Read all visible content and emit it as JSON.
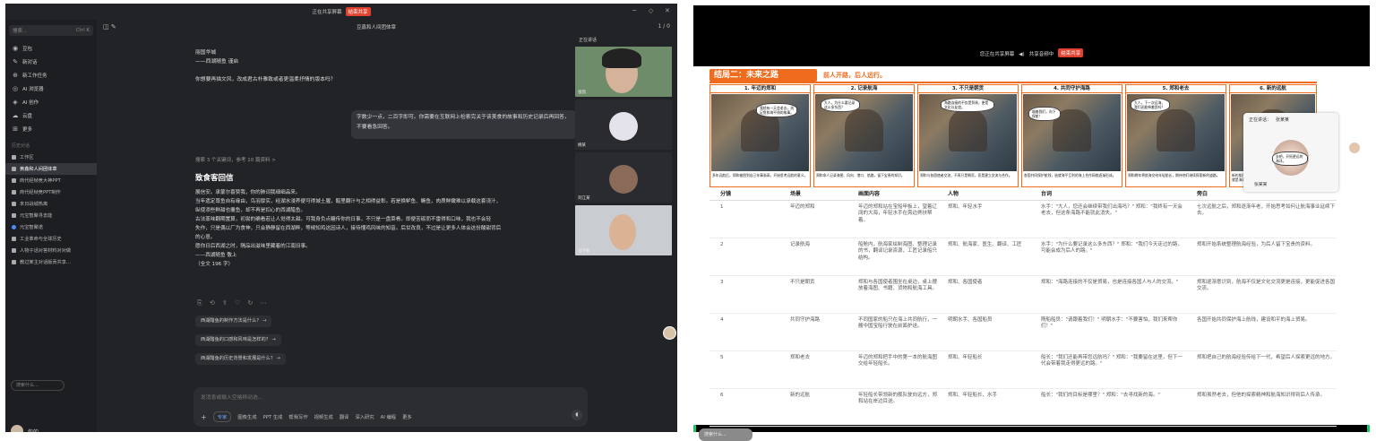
{
  "left": {
    "topbar": {
      "sharing": "正在共享屏幕",
      "stop": "结束共享"
    },
    "sidebar": {
      "search": "搜索...",
      "shortcut": "Ctrl K",
      "nav": [
        "豆包",
        "新对话",
        "新工作任务",
        "AI 浏览器",
        "AI 创作",
        "云盘",
        "更多"
      ],
      "section": "历史对话",
      "history": [
        "工作区",
        "黄鑫和人间团体章",
        "商代经帧竞大神PPT",
        "商代经帧竞PPT制作",
        "末日战城热离",
        "元宝智聚寻去能",
        "元宝智聚诺",
        "工业革命与全球历史",
        "人物子话对答材料对对做",
        "教过某主对话版贡共享…"
      ],
      "search_box": "搜索什么...",
      "username": "你的"
    },
    "main": {
      "title": "豆鑫和人间团体章",
      "header_right": "1 / 0",
      "chat_lines": [
        "丽国华城",
        "——西湖随鱼 谨启",
        "你想要再描文风，改成君古朴雅致或者更温柔抒情的版本吗？"
      ],
      "bubble": "字数少一点，二百字即可。你需要在互联网上检索完关于该美食的故事和历史记录后再回答，不要看急回答。",
      "search_note": "搜索 3 个关键词，参考 10 篇资料 >",
      "reply_title": "致食客回信",
      "reply_lines": [
        "展信安。承蒙尔喜赞我，你的肺词我细细品来。",
        "当年遗定尊鱼自有缘由，鸟羽厚实，经湖水浸养便可得城土腥，醋里翻汁与之相得益彰。若是换鲈鱼、鳜鱼，肉质鲜嫩难以承载这套浇汁，",
        "纵使添些鲜甜也覆鱼，却不再是扣心的西湖醋鱼。",
        "古法蒸味翻期置算，初尝的确看若让人觉得太甜。可我身负点糖传你的日事，不只是一盘菜肴。即便苦砺而不雷得和口味，我也不会轻",
        "失作，只是偶以厂为食神，只会静静留在西湖畔，等候知鸡这因诗人，接待懂鸡风味的知音。后甘改良，不过是让更多人体会这份酸甜背后",
        "的心意。",
        "愿你日后西湖之时，隔品出滋味里藏着的江南旧事。",
        "——西湖随鱼 敬上",
        "（全文 196 字）"
      ],
      "suggestions": [
        "西湖醋鱼的制作方法是什么？ →",
        "西湖醋鱼的口感和风味是怎样的？ →",
        "西湖醋鱼的历史背景和发展是什么？ →"
      ],
      "input_placeholder": "发消息或输入空格移动选...",
      "tools": [
        "专家",
        "图像生成",
        "PPT 生成",
        "帮我写作",
        "视频生成",
        "翻译",
        "深入研究",
        "AI 编程",
        "更多"
      ]
    },
    "video": {
      "header": "正在讲话",
      "names": [
        "张凯",
        "杨某",
        "刘江某",
        "甘子枫"
      ]
    }
  },
  "right": {
    "topbar": {
      "sharing": "您正在共享屏幕",
      "audio": "共享音频中",
      "stop": "结束共享"
    },
    "slide": {
      "banner": "结局二：未来之路",
      "subtitle": "前人开路，后人远行。",
      "panels": [
        {
          "title": "1. 年迈的郑和",
          "speech": "我经有一天会老去，流足鱼和海平线的故事。",
          "caption": "多年远航后，郑和被困到自己年事渐高，开始思考远航的意义。"
        },
        {
          "title": "2. 记录航海",
          "speech": "大人，为什么要记录这么多东西？",
          "caption": "郑和命人记录海图、风向、港口、航路，留下宝贵的知识。"
        },
        {
          "title": "3. 不只是朝贡",
          "speech": "海路连接的不仅是贸易，更是文化与友谊。",
          "caption": "郑和与各国使者交流，不再只是朝贡，而是建立交流与合作。"
        },
        {
          "title": "4. 共同守护海路",
          "speech": "顺着我们，向下保航！",
          "caption": "各国共同保护航线，造就海平互利的海上合作网络逐渐形成。"
        },
        {
          "title": "5. 郑和老去",
          "speech": "大人，下一次远海，我们还能带着您吗？",
          "caption": "郑和晚年将航海交给年轻船长，期待他们继续探索新的道路。"
        },
        {
          "title": "6. 新的远航",
          "speech": "去吧，开拓更远的海洋。",
          "caption": "新的船队扬帆远航，郑和的精神与知识被后人传承，这就是海事精神的永恒。"
        }
      ],
      "table": {
        "headers": [
          "分镜",
          "场景",
          "画面内容",
          "人物",
          "台词",
          "旁白"
        ],
        "rows": [
          [
            "1",
            "年迈的郑和",
            "年迈的郑和站在宝船甲板上，望着辽阔的大海，年轻水手在旁边搀扶帮着。",
            "郑和、年轻水手",
            "水手：\"大人，您还会继续带我们出海吗？\" 郑和：\"我终有一天会老去，但这条海路不能就此消失。\"",
            "七次远航之后，郑和逐渐年老，开始思考如何让航海事业延续下去。"
          ],
          [
            "2",
            "记录航海",
            "船舱内，航海家绘制海图、整理记录的书，翻译记录资源，工匠记录船只结构。",
            "郑和、航海家、医生、翻译、工匠",
            "水手：\"为什么要记录这么多东西？\" 郑和：\"我们今天走过的路，可能会成为后人的路。\"",
            "郑和开始系统整理航海经验，为后人留下宝贵的资料。"
          ],
          [
            "3",
            "不只是朝贡",
            "郑和与各国使者围坐在桌边，桌上摆放着海图、书籍、货物和航海工具。",
            "郑和、各国使者",
            "郑和：\"海路连接的不仅是贸易，也是连接各国人与人的交流。\"",
            "郑和逐渐意识到，航海不仅是文化交流更是连接，更能促进各国交流。"
          ],
          [
            "4",
            "共同守护海路",
            "不同国家的船只在海上共同航行，一艘中国宝船行驶在前面护送。",
            "明朝水手、各国船员",
            "隋船船员：\"请跟着我们！\" 明朝水手：\"不要害怕，我们来帮你们！\"",
            "各国开始共同保护海上航线，建设和平的海上贸易。"
          ],
          [
            "5",
            "郑和老去",
            "年迈的郑和把手中的第一本的航海图交给年轻船长。",
            "郑和、年轻船长",
            "船长：\"我们还能再带您远航吗？\" 郑和：\"我要留在这里，但下一代会带着我走得更远的路。\"",
            "郑和把自己的航海经验传给下一代，希望后人探索更远的地方。"
          ],
          [
            "6",
            "新的远航",
            "年轻船长带领新的舰队驶向远方，郑和站在岸边目送。",
            "郑和、年轻船长、水手",
            "船长：\"我们的目标是哪里？\" 郑和：\"去寻找新的海。\"",
            "郑和虽然老去，但他的探索精神和航海知识得到后人传承。"
          ]
        ]
      }
    },
    "video": {
      "speaking": "正在讲话：",
      "speaker": "张某某",
      "name": "张某某"
    },
    "search_box": "搜索什么..."
  }
}
